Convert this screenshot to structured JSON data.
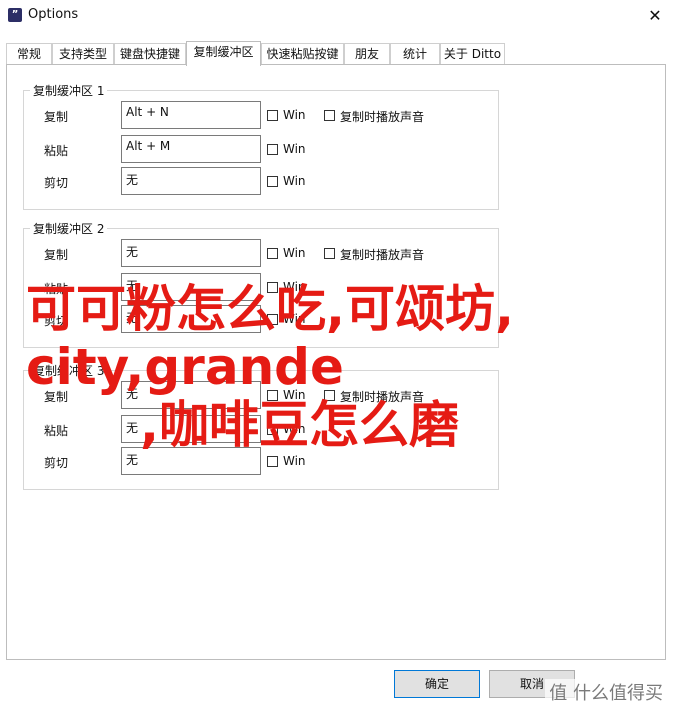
{
  "window": {
    "title": "Options",
    "icon": "ditto-app-icon",
    "close_glyph": "✕"
  },
  "tabs": [
    {
      "label": "常规"
    },
    {
      "label": "支持类型"
    },
    {
      "label": "键盘快捷键"
    },
    {
      "label": "复制缓冲区",
      "active": true
    },
    {
      "label": "快速粘贴按键"
    },
    {
      "label": "朋友"
    },
    {
      "label": "统计"
    },
    {
      "label": "关于 Ditto"
    }
  ],
  "groups": [
    {
      "title": "复制缓冲区 1",
      "rows": [
        {
          "label": "复制",
          "value": "Alt + N",
          "win": "Win",
          "sound": "复制时播放声音"
        },
        {
          "label": "粘贴",
          "value": "Alt + M",
          "win": "Win"
        },
        {
          "label": "剪切",
          "value": "无",
          "win": "Win"
        }
      ]
    },
    {
      "title": "复制缓冲区 2",
      "rows": [
        {
          "label": "复制",
          "value": "无",
          "win": "Win",
          "sound": "复制时播放声音"
        },
        {
          "label": "粘贴",
          "value": "无",
          "win": "Win"
        },
        {
          "label": "剪切",
          "value": "无",
          "win": "Win"
        }
      ]
    },
    {
      "title": "复制缓冲区 3",
      "rows": [
        {
          "label": "复制",
          "value": "无",
          "win": "Win",
          "sound": "复制时播放声音"
        },
        {
          "label": "粘贴",
          "value": "无",
          "win": "Win"
        },
        {
          "label": "剪切",
          "value": "无",
          "win": "Win"
        }
      ]
    }
  ],
  "buttons": {
    "ok": "确定",
    "cancel": "取消"
  },
  "overlay": {
    "line1": "可可粉怎么吃,可颂坊,",
    "line2": "city,grande",
    "line3": ",咖啡豆怎么磨",
    "color": "#e51b14"
  },
  "watermark": "值 什么值得买"
}
